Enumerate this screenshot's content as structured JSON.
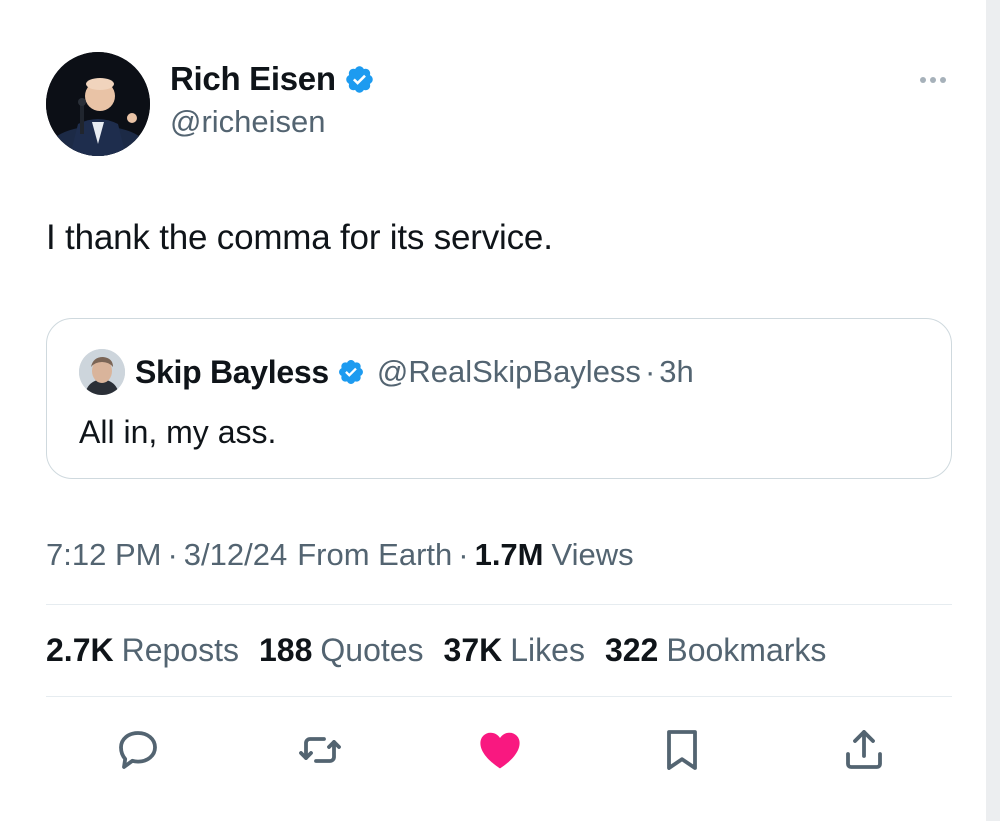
{
  "author": {
    "name": "Rich Eisen",
    "handle": "@richeisen"
  },
  "tweet": {
    "text": "I thank the comma for its service."
  },
  "quote": {
    "name": "Skip Bayless",
    "handle": "@RealSkipBayless",
    "separator": "·",
    "time": "3h",
    "text": "All in, my ass."
  },
  "meta": {
    "time": "7:12 PM",
    "dot1": "·",
    "date": "3/12/24",
    "source": "From Earth",
    "dot2": "·",
    "views_count": "1.7M",
    "views_label": "Views"
  },
  "stats": [
    {
      "num": "2.7K",
      "label": "Reposts"
    },
    {
      "num": "188",
      "label": "Quotes"
    },
    {
      "num": "37K",
      "label": "Likes"
    },
    {
      "num": "322",
      "label": "Bookmarks"
    }
  ],
  "icons": {
    "reply": "reply-icon",
    "repost": "repost-icon",
    "like": "heart-icon",
    "bookmark": "bookmark-icon",
    "share": "share-icon",
    "more": "more-icon",
    "verified": "verified-badge-icon"
  },
  "colors": {
    "text": "#0f1419",
    "secondary": "#536471",
    "verified": "#1d9bf0",
    "liked": "#f91880",
    "border": "#cfd9de"
  }
}
